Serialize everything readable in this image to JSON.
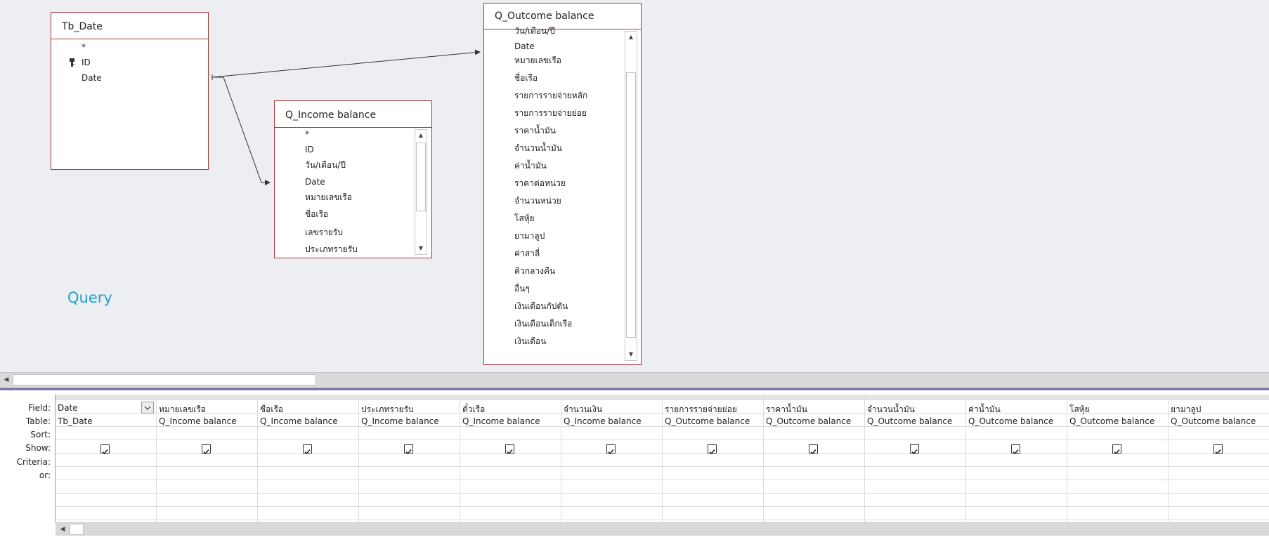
{
  "tables": {
    "tb_date": {
      "title": "Tb_Date",
      "fields": [
        "*",
        "ID",
        "Date"
      ]
    },
    "q_income": {
      "title": "Q_Income balance",
      "fields": [
        "*",
        "ID",
        "วัน/เดือน/ปี",
        "Date",
        "หมายเลขเรือ",
        "ชื่อเรือ",
        "เลขรายรับ",
        "ประเภทรายรับ"
      ]
    },
    "q_outcome": {
      "title": "Q_Outcome balance",
      "fields": [
        "วัน/เดือน/ปี",
        "Date",
        "หมายเลขเรือ",
        "ชื่อเรือ",
        "รายการรายจ่ายหลัก",
        "รายการรายจ่ายย่อย",
        "ราคาน้ำมัน",
        "จำนวนน้ำมัน",
        "ค่าน้ำมัน",
        "ราคาต่อหน่วย",
        "จำนวนหน่วย",
        "โสหุ้ย",
        "ยามาลูป",
        "ค่าสาลี่",
        "คิวกลางคืน",
        "อื่นๆ",
        "เงินเดือนกัปตัน",
        "เงินเดือนเด็กเรือ",
        "เงินเดือน"
      ]
    }
  },
  "caption": "Query",
  "grid": {
    "row_labels": [
      "Field:",
      "Table:",
      "Sort:",
      "Show:",
      "Criteria:",
      "or:"
    ],
    "columns": [
      {
        "field": "Date",
        "table": "Tb_Date",
        "sort": "",
        "show": true
      },
      {
        "field": "หมายเลขเรือ",
        "table": "Q_Income balance",
        "sort": "",
        "show": true
      },
      {
        "field": "ชื่อเรือ",
        "table": "Q_Income balance",
        "sort": "",
        "show": true
      },
      {
        "field": "ประเภทรายรับ",
        "table": "Q_Income balance",
        "sort": "",
        "show": true
      },
      {
        "field": "ตั๋วเรือ",
        "table": "Q_Income balance",
        "sort": "",
        "show": true
      },
      {
        "field": "จำนวนเงิน",
        "table": "Q_Income balance",
        "sort": "",
        "show": true
      },
      {
        "field": "รายการรายจ่ายย่อย",
        "table": "Q_Outcome balance",
        "sort": "",
        "show": true
      },
      {
        "field": "ราคาน้ำมัน",
        "table": "Q_Outcome balance",
        "sort": "",
        "show": true
      },
      {
        "field": "จำนวนน้ำมัน",
        "table": "Q_Outcome balance",
        "sort": "",
        "show": true
      },
      {
        "field": "ค่าน้ำมัน",
        "table": "Q_Outcome balance",
        "sort": "",
        "show": true
      },
      {
        "field": "โสหุ้ย",
        "table": "Q_Outcome balance",
        "sort": "",
        "show": true
      },
      {
        "field": "ยามาลูป",
        "table": "Q_Outcome balance",
        "sort": "",
        "show": true
      }
    ]
  },
  "colors": {
    "table_border": "#a4373a",
    "caption": "#1e9fd0",
    "splitter": "#7b7aa6",
    "designer_bg": "#eceef2"
  }
}
